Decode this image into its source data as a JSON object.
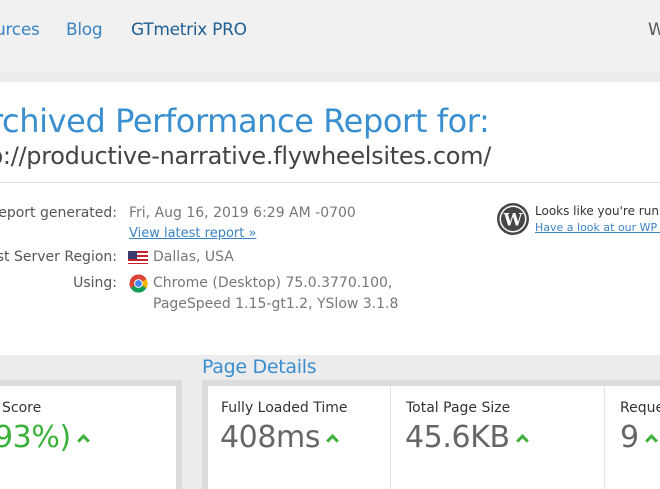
{
  "nav": {
    "resources": "urces",
    "blog": "Blog",
    "pro": "GTmetrix PRO",
    "right_cut": "W"
  },
  "report": {
    "title_line1": "rchived Performance Report for:",
    "title_line2": "p://productive-narrative.flywheelsites.com/",
    "generated_label": "eport generated:",
    "generated_value": "Fri, Aug 16, 2019 6:29 AM -0700",
    "view_latest": "View latest report »",
    "region_label": "st Server Region:",
    "region_value": "Dallas, USA",
    "using_label": "Using:",
    "using_line1": "Chrome (Desktop) 75.0.3770.100,",
    "using_line2": "PageSpeed 1.15-gt1.2, YSlow 3.1.8"
  },
  "wp_notice": {
    "text": "Looks like you're runnin",
    "link": "Have a look at our WP op"
  },
  "scores": {
    "label": "Score",
    "value": "93%)"
  },
  "page_details": {
    "title": "Page Details",
    "fully_loaded_label": "Fully Loaded Time",
    "fully_loaded_value": "408ms",
    "size_label": "Total Page Size",
    "size_value": "45.6KB",
    "requests_label": "Reque",
    "requests_value": "9"
  },
  "colors": {
    "brand_blue": "#3a8fd0",
    "link_blue": "#3a84c3",
    "good_green": "#3ab23a"
  }
}
